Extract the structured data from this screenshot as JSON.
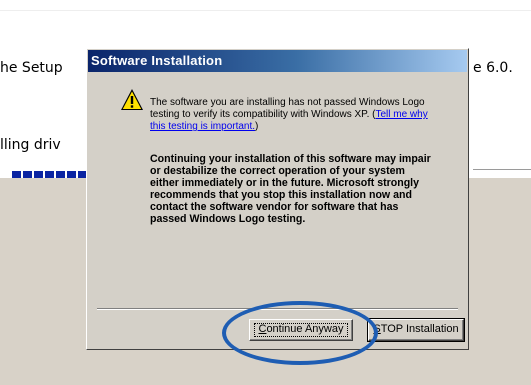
{
  "background": {
    "text_left_top": "he Setup",
    "text_right_top": "e 6.0.",
    "text_left_mid": "lling driv",
    "progress_blocks": 7
  },
  "dialog": {
    "title": "Software Installation",
    "message_lines": [
      "The software you are installing has not passed Windows Logo",
      "testing to verify its compatibility with Windows XP. ("
    ],
    "link_part1": "Tell me why",
    "link_part2": "this testing is important.",
    "message_close": ")",
    "warning_lines": [
      "Continuing your installation of this software may impair",
      "or destabilize the correct operation of your system",
      "either immediately or in the future. Microsoft strongly",
      "recommends that you stop this installation now and",
      "contact the software vendor for software that has",
      "passed Windows Logo testing."
    ],
    "continue_first": "C",
    "continue_rest": "ontinue Anyway",
    "stop_first": "S",
    "stop_rest": "TOP Installation"
  },
  "colors": {
    "title_gradient_start": "#0a246a",
    "highlight_circle": "#1e5db3",
    "progress": "#0a24a2"
  },
  "icons": [
    "warning-triangle-icon"
  ]
}
